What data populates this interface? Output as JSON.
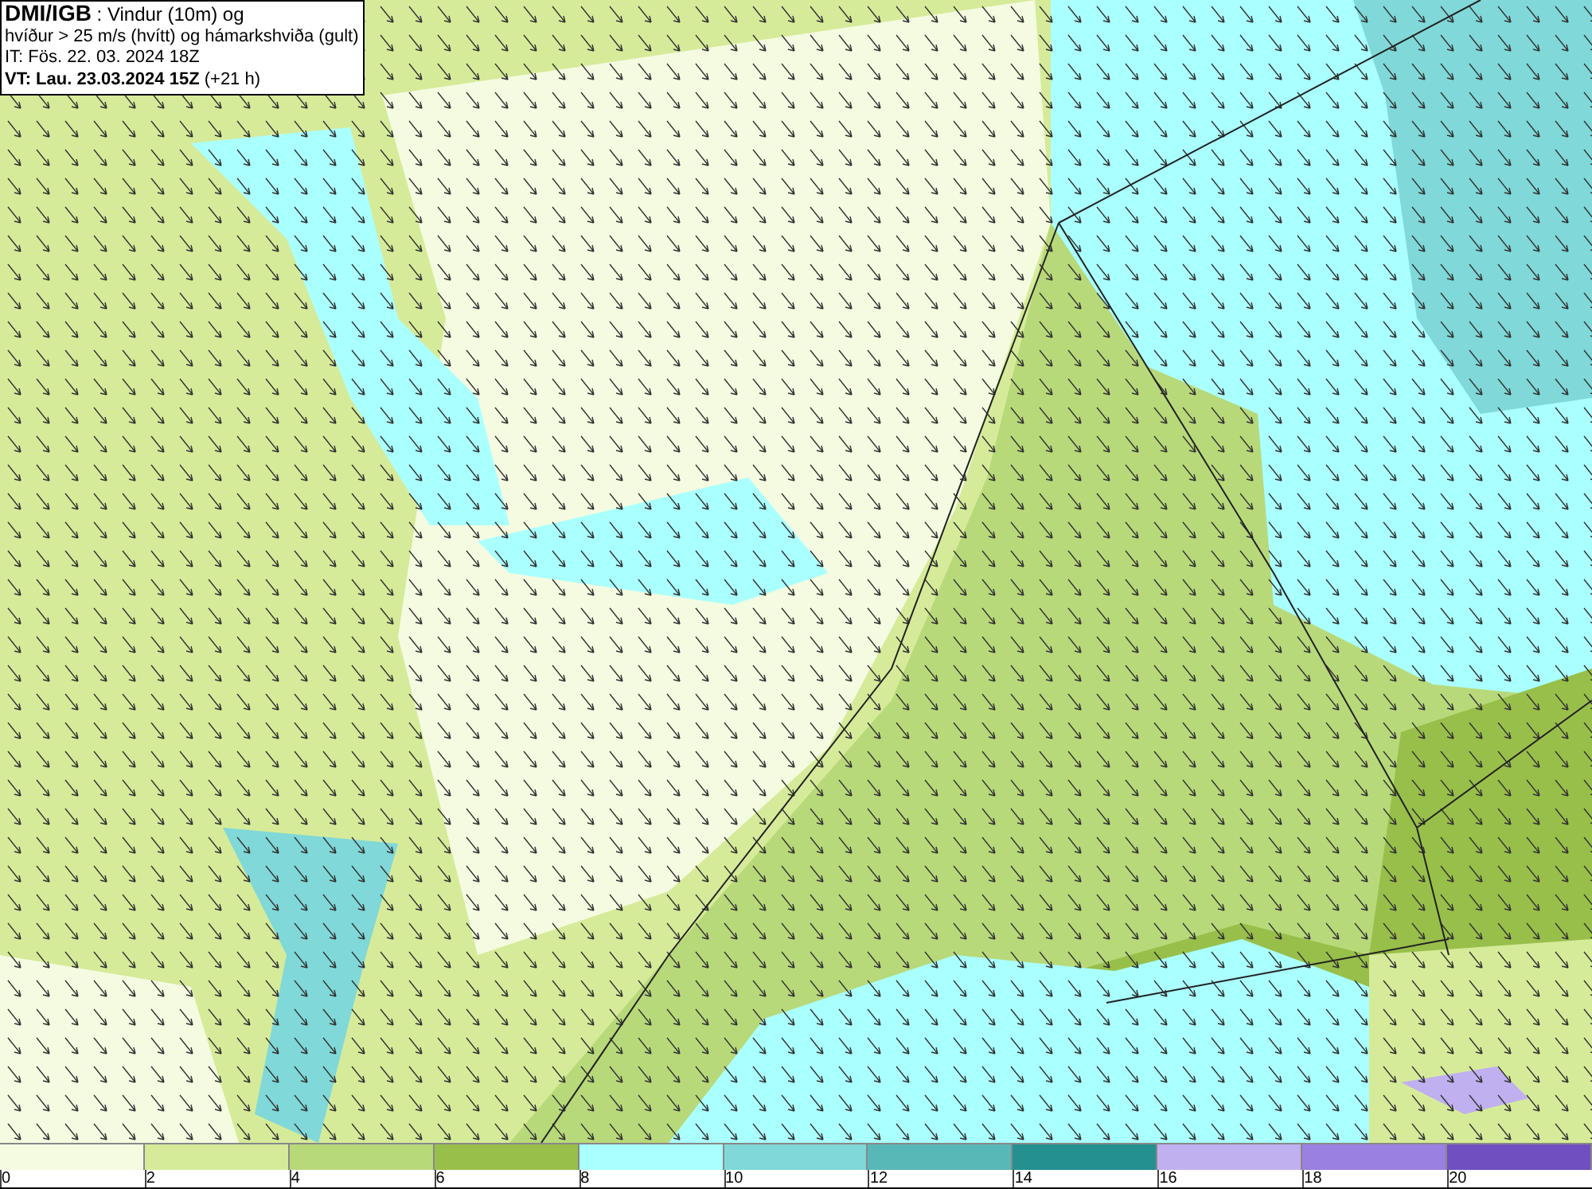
{
  "header": {
    "lines": [
      "**DMI/IGB** : Vindur (10m) og",
      "hvíður > 25 m/s (hvítt) og hámarkshviða (gult)",
      "IT: Fös. 22. 03. 2024 18Z",
      "**VT: Lau. 23.03.2024 15Z** (+21 h)"
    ]
  },
  "legend": {
    "segments": [
      {
        "color": "#f4fbe0",
        "label": "0"
      },
      {
        "color": "#d6eb99",
        "label": "2"
      },
      {
        "color": "#b8d97a",
        "label": "4"
      },
      {
        "color": "#98bf4a",
        "label": "6"
      },
      {
        "color": "#aaffff",
        "label": "8"
      },
      {
        "color": "#80d8d8",
        "label": "10"
      },
      {
        "color": "#58b8b8",
        "label": "12"
      },
      {
        "color": "#249090",
        "label": "14"
      },
      {
        "color": "#c0b0f0",
        "label": "16"
      },
      {
        "color": "#9a80e0",
        "label": "18"
      },
      {
        "color": "#7050c0",
        "label": "20"
      }
    ]
  }
}
